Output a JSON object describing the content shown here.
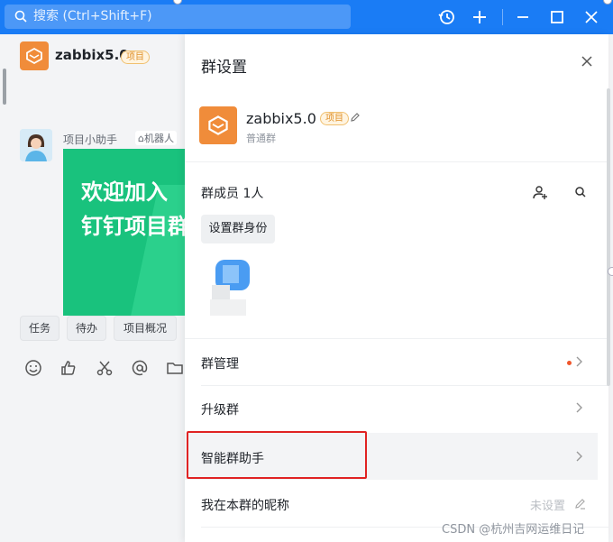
{
  "topbar": {
    "search_placeholder": "搜索 (Ctrl+Shift+F)"
  },
  "chat": {
    "title": "zabbix5.0",
    "tag": "项目",
    "sender": "项目小助手",
    "robot_badge": "机器人",
    "welcome_line1": "欢迎加入",
    "welcome_line2": "钉钉项目群",
    "quick_buttons": [
      "任务",
      "待办",
      "项目概况"
    ]
  },
  "panel": {
    "title": "群设置",
    "group_name": "zabbix5.0",
    "group_tag": "项目",
    "group_type": "普通群",
    "members_label": "群成员 1人",
    "set_role_button": "设置群身份",
    "rows": {
      "manage": "群管理",
      "upgrade": "升级群",
      "assistant": "智能群助手",
      "nickname": "我在本群的昵称",
      "nickname_value": "未设置"
    }
  },
  "watermark": "CSDN @杭州吉网运维日记",
  "colors": {
    "accent": "#1a7cf5",
    "brand_orange": "#f08c3a",
    "card_green": "#19c27d",
    "highlight_red": "#e02323"
  }
}
